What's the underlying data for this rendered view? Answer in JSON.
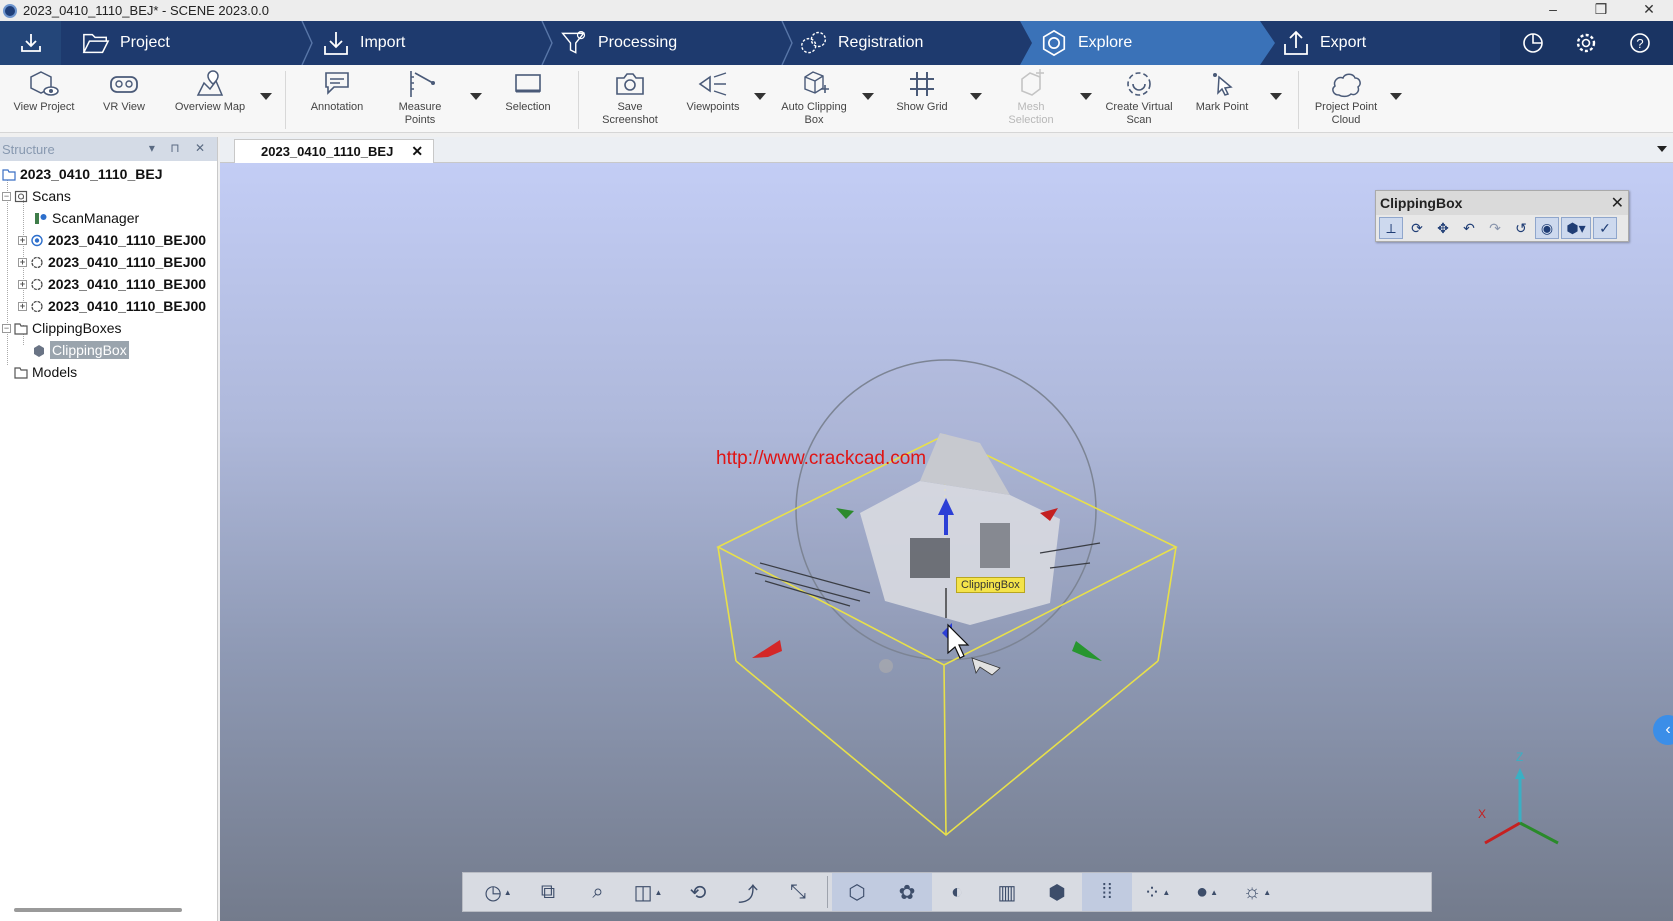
{
  "window": {
    "title": "2023_0410_1110_BEJ* - SCENE 2023.0.0",
    "controls": [
      "–",
      "❒",
      "✕"
    ]
  },
  "workflow": {
    "tabs": [
      {
        "label": "Project",
        "icon": "folder-open-icon"
      },
      {
        "label": "Import",
        "icon": "download-icon"
      },
      {
        "label": "Processing",
        "icon": "filter-icon"
      },
      {
        "label": "Registration",
        "icon": "registration-icon"
      },
      {
        "label": "Explore",
        "icon": "explore-icon",
        "active": true
      },
      {
        "label": "Export",
        "icon": "upload-icon"
      }
    ],
    "right_icons": [
      "pie-chart-icon",
      "gear-icon",
      "help-icon"
    ]
  },
  "ribbon": {
    "buttons": [
      {
        "label": "View Project",
        "icon": "view-project-icon"
      },
      {
        "label": "VR View",
        "icon": "vr-headset-icon"
      },
      {
        "label": "Overview Map",
        "icon": "map-icon"
      },
      {
        "label": "Annotation",
        "icon": "annotation-icon"
      },
      {
        "label": "Measure Points",
        "icon": "measure-icon"
      },
      {
        "label": "Selection",
        "icon": "selection-icon"
      },
      {
        "label": "Save Screenshot",
        "icon": "camera-icon"
      },
      {
        "label": "Viewpoints",
        "icon": "viewpoints-icon"
      },
      {
        "label": "Auto Clipping Box",
        "icon": "auto-clipping-box-icon"
      },
      {
        "label": "Show Grid",
        "icon": "grid-icon"
      },
      {
        "label": "Mesh Selection",
        "icon": "mesh-selection-icon",
        "disabled": true
      },
      {
        "label": "Create Virtual Scan",
        "icon": "virtual-scan-icon"
      },
      {
        "label": "Mark Point",
        "icon": "mark-point-icon"
      },
      {
        "label": "Project Point Cloud",
        "icon": "point-cloud-icon"
      }
    ]
  },
  "structure": {
    "header": "Structure",
    "root": "2023_0410_1110_BEJ",
    "scans_label": "Scans",
    "scan_manager": "ScanManager",
    "scans": [
      "2023_0410_1110_BEJ00",
      "2023_0410_1110_BEJ00",
      "2023_0410_1110_BEJ00",
      "2023_0410_1110_BEJ00"
    ],
    "clipping_boxes_label": "ClippingBoxes",
    "clipping_box": "ClippingBox",
    "models_label": "Models"
  },
  "document": {
    "tab_label": "2023_0410_1110_BEJ"
  },
  "viewport": {
    "watermark": "http://www.crackcad.com",
    "tooltip": "ClippingBox",
    "axis_labels": {
      "z": "Z",
      "x": "X"
    },
    "box_color": "#e8e04a"
  },
  "clipping_panel": {
    "title": "ClippingBox",
    "tools": [
      "axes-icon",
      "rotate-icon",
      "move-icon",
      "undo-icon",
      "redo-icon",
      "reset-icon",
      "eye-icon",
      "box-dropdown-icon",
      "check-icon"
    ]
  },
  "bottom_toolbar": {
    "tools": [
      "navigation-mode-icon",
      "zoom-extents-icon",
      "zoom-icon",
      "view-cube-icon",
      "orbit-icon",
      "walk-icon",
      "fly-icon",
      "clipping-box-mode-icon",
      "point-cloud-mode-icon",
      "contrast-icon",
      "point-density-icon",
      "box-outline-icon",
      "grid-dots-icon",
      "point-size-icon",
      "color-wheel-icon",
      "lighting-icon"
    ]
  },
  "colors": {
    "workflow_bg": "#1e3a6e",
    "active_tab": "#3a72b8",
    "selection_bg": "#9aa4ad"
  }
}
